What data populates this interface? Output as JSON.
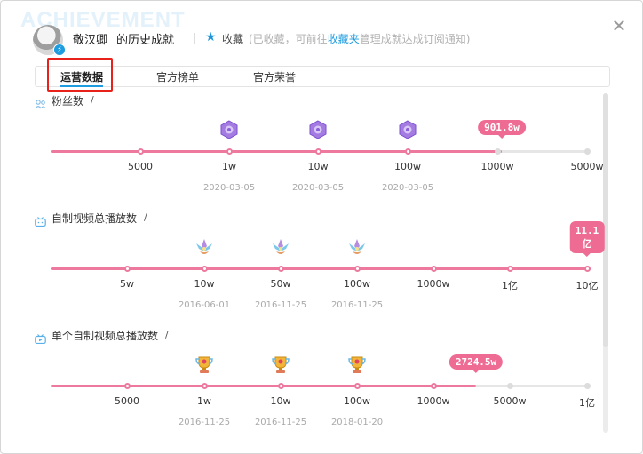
{
  "watermark": "ACHIEVEMENT",
  "header": {
    "username": "敬汉卿",
    "title": "的历史成就",
    "favorite_label": "收藏",
    "favorite_note_pre": "(已收藏，可前往",
    "favorite_note_link": "收藏夹",
    "favorite_note_post": "管理成就达成订阅通知)",
    "close_icon": "close-icon"
  },
  "tabs": [
    {
      "label": "运营数据",
      "active": true
    },
    {
      "label": "官方榜单",
      "active": false
    },
    {
      "label": "官方荣誉",
      "active": false
    }
  ],
  "colors": {
    "accent": "#1e9ce0",
    "progress": "#ed7a9e",
    "bubble": "#ee6c93",
    "highlight": "#e8221b"
  },
  "sections": [
    {
      "title": "粉丝数",
      "slash": "/",
      "icon": "fans-icon",
      "milestones": [
        "5000",
        "1w",
        "10w",
        "100w",
        "1000w",
        "5000w"
      ],
      "reached": 4,
      "progress": 0.836,
      "current": "901.8w",
      "badges": [
        {
          "milestone": 1,
          "icon": "purple-gem-badge-icon"
        },
        {
          "milestone": 2,
          "icon": "purple-gem-badge-icon"
        },
        {
          "milestone": 3,
          "icon": "purple-gem-badge-icon"
        }
      ],
      "dates": [
        {
          "milestone": 1,
          "text": "2020-03-05"
        },
        {
          "milestone": 2,
          "text": "2020-03-05"
        },
        {
          "milestone": 3,
          "text": "2020-03-05"
        }
      ]
    },
    {
      "title": "自制视频总播放数",
      "slash": "/",
      "icon": "tv-icon",
      "milestones": [
        "",
        "5w",
        "10w",
        "50w",
        "100w",
        "1000w",
        "1亿",
        "10亿"
      ],
      "reached": 8,
      "progress": 1.0,
      "current": "11.1\n亿",
      "badges": [
        {
          "milestone": 2,
          "icon": "lotus-badge-icon"
        },
        {
          "milestone": 3,
          "icon": "lotus-badge-icon"
        },
        {
          "milestone": 4,
          "icon": "lotus-badge-icon"
        }
      ],
      "dates": [
        {
          "milestone": 2,
          "text": "2016-06-01"
        },
        {
          "milestone": 3,
          "text": "2016-11-25"
        },
        {
          "milestone": 4,
          "text": "2016-11-25"
        }
      ]
    },
    {
      "title": "单个自制视频总播放数",
      "slash": "/",
      "icon": "tv-play-icon",
      "milestones": [
        "",
        "5000",
        "1w",
        "10w",
        "100w",
        "1000w",
        "5000w",
        "1亿"
      ],
      "reached": 6,
      "progress": 0.788,
      "current": "2724.5w",
      "badges": [
        {
          "milestone": 2,
          "icon": "trophy-badge-icon"
        },
        {
          "milestone": 3,
          "icon": "trophy-badge-icon"
        },
        {
          "milestone": 4,
          "icon": "trophy-badge-icon"
        }
      ],
      "dates": [
        {
          "milestone": 2,
          "text": "2016-11-25"
        },
        {
          "milestone": 3,
          "text": "2016-11-25"
        },
        {
          "milestone": 4,
          "text": "2018-01-20"
        }
      ]
    }
  ]
}
